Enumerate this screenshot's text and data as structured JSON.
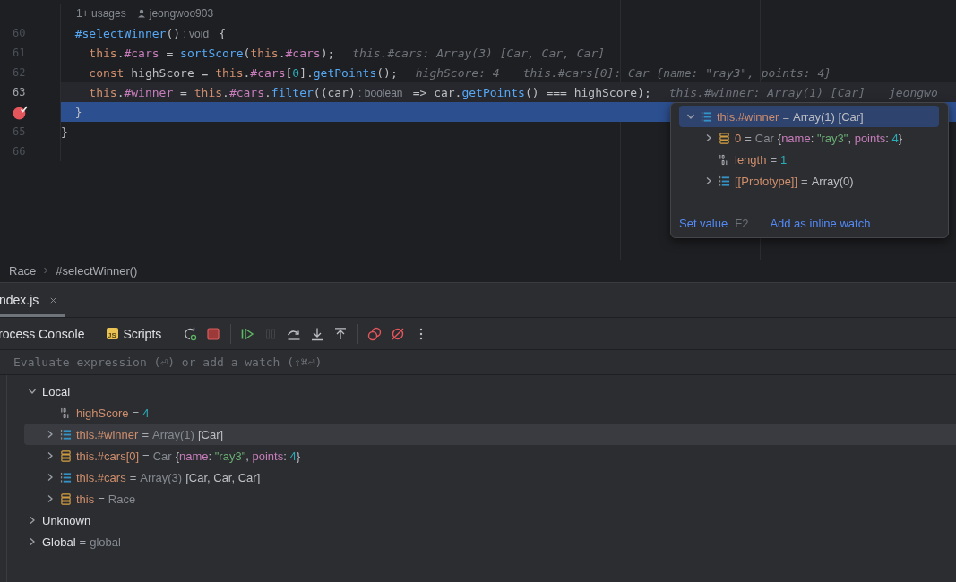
{
  "editor": {
    "usages": {
      "count": "1+ usages",
      "author": "jeongwoo903"
    },
    "lines": [
      {
        "number": "60",
        "breakpoint": false,
        "current_line": false,
        "execution_point": false,
        "tokens": [
          {
            "text": "  #selectWinner",
            "kind": "fn"
          },
          {
            "text": "()",
            "kind": "plain"
          },
          {
            "text": " : void ",
            "kind": "type_hint"
          },
          {
            "text": " {",
            "kind": "plain"
          }
        ]
      },
      {
        "number": "61",
        "breakpoint": false,
        "current_line": false,
        "execution_point": false,
        "tokens": [
          {
            "text": "    this",
            "kind": "kw"
          },
          {
            "text": ".",
            "kind": "plain"
          },
          {
            "text": "#cars",
            "kind": "field"
          },
          {
            "text": " = ",
            "kind": "plain"
          },
          {
            "text": "sortScore",
            "kind": "fn"
          },
          {
            "text": "(",
            "kind": "plain"
          },
          {
            "text": "this",
            "kind": "kw"
          },
          {
            "text": ".",
            "kind": "plain"
          },
          {
            "text": "#cars",
            "kind": "field"
          },
          {
            "text": ");",
            "kind": "plain"
          }
        ],
        "hints": [
          "this.#cars: Array(3) [Car, Car, Car]"
        ]
      },
      {
        "number": "62",
        "breakpoint": false,
        "current_line": false,
        "execution_point": false,
        "tokens": [
          {
            "text": "    const",
            "kind": "kw"
          },
          {
            "text": " highScore = ",
            "kind": "plain"
          },
          {
            "text": "this",
            "kind": "kw"
          },
          {
            "text": ".",
            "kind": "plain"
          },
          {
            "text": "#cars",
            "kind": "field"
          },
          {
            "text": "[",
            "kind": "plain"
          },
          {
            "text": "0",
            "kind": "num"
          },
          {
            "text": "].",
            "kind": "plain"
          },
          {
            "text": "getPoints",
            "kind": "fn"
          },
          {
            "text": "();",
            "kind": "plain"
          }
        ],
        "hints": [
          "highScore: 4",
          "this.#cars[0]: Car {name: \"ray3\", points: 4}"
        ]
      },
      {
        "number": "63",
        "breakpoint": false,
        "current_line": true,
        "execution_point": false,
        "tokens": [
          {
            "text": "    this",
            "kind": "kw"
          },
          {
            "text": ".",
            "kind": "plain"
          },
          {
            "text": "#winner",
            "kind": "field"
          },
          {
            "text": " = ",
            "kind": "plain"
          },
          {
            "text": "this",
            "kind": "kw"
          },
          {
            "text": ".",
            "kind": "plain"
          },
          {
            "text": "#cars",
            "kind": "field"
          },
          {
            "text": ".",
            "kind": "plain"
          },
          {
            "text": "filter",
            "kind": "fn"
          },
          {
            "text": "((car)",
            "kind": "plain"
          },
          {
            "text": " : boolean ",
            "kind": "type_hint"
          },
          {
            "text": " => car.",
            "kind": "plain"
          },
          {
            "text": "getPoints",
            "kind": "fn"
          },
          {
            "text": "() === highScore);",
            "kind": "plain"
          }
        ],
        "hints": [
          "this.#winner: Array(1) [Car]",
          "jeongwo"
        ]
      },
      {
        "breakpoint": true,
        "current_line": false,
        "execution_point": true,
        "tokens": [
          {
            "text": "  }",
            "kind": "plain"
          }
        ]
      },
      {
        "number": "65",
        "breakpoint": false,
        "current_line": false,
        "execution_point": false,
        "tokens": [
          {
            "text": "}",
            "kind": "plain"
          }
        ]
      },
      {
        "number": "66",
        "breakpoint": false,
        "current_line": false,
        "execution_point": false
      }
    ]
  },
  "popup": {
    "items": [
      {
        "kind": "array",
        "expanded": true,
        "selected": true,
        "name": "this.#winner",
        "value": [
          {
            "text": "=",
            "kind": "eq"
          },
          {
            "text": "Array(1) [Car]",
            "kind": "plain"
          }
        ],
        "children": [
          {
            "kind": "object",
            "expanded": false,
            "selected": false,
            "name": "0",
            "value": [
              {
                "text": "=",
                "kind": "eq"
              },
              {
                "text": "Car",
                "kind": "type"
              },
              {
                "text": "{",
                "kind": "plain"
              },
              {
                "text": "name",
                "kind": "key"
              },
              {
                "text": ": ",
                "kind": "plain"
              },
              {
                "text": "\"ray3\"",
                "kind": "str"
              },
              {
                "text": ", ",
                "kind": "plain"
              },
              {
                "text": "points",
                "kind": "key"
              },
              {
                "text": ": ",
                "kind": "plain"
              },
              {
                "text": "4",
                "kind": "num"
              },
              {
                "text": "}",
                "kind": "plain"
              }
            ]
          },
          {
            "kind": "number",
            "selected": false,
            "name": "length",
            "value": [
              {
                "text": "=",
                "kind": "eq"
              },
              {
                "text": "1",
                "kind": "num"
              }
            ]
          },
          {
            "kind": "array",
            "expanded": false,
            "selected": false,
            "name": "[[Prototype]]",
            "value": [
              {
                "text": "=",
                "kind": "eq"
              },
              {
                "text": "Array(0)",
                "kind": "plain"
              }
            ]
          }
        ]
      }
    ],
    "actions": [
      {
        "label": "Set value",
        "shortcut": "F2"
      },
      {
        "label": "Add as inline watch"
      }
    ]
  },
  "breadcrumb": [
    "Race",
    "#selectWinner()"
  ],
  "debug_tabs": [
    {
      "label": "ndex.js",
      "selected": true
    }
  ],
  "toolbar": {
    "tabs": [
      {
        "label": "rocess Console"
      },
      {
        "label": "Scripts",
        "badge": "JS"
      }
    ],
    "buttons": [
      {
        "kind": "rerun",
        "disabled": false
      },
      {
        "kind": "stop",
        "disabled": false
      },
      {
        "kind": "separator"
      },
      {
        "kind": "resume",
        "disabled": false
      },
      {
        "kind": "pause",
        "disabled": true
      },
      {
        "kind": "step_over",
        "disabled": false
      },
      {
        "kind": "step_into",
        "disabled": false
      },
      {
        "kind": "step_out",
        "disabled": false
      },
      {
        "kind": "separator"
      },
      {
        "kind": "breakpoints",
        "disabled": false
      },
      {
        "kind": "mute",
        "disabled": false
      },
      {
        "kind": "more",
        "disabled": false
      }
    ]
  },
  "evaluate": {
    "placeholder": "Evaluate expression (⏎) or add a watch (⇧⌘⏎)"
  },
  "variables": {
    "items": [
      {
        "kind": "scope",
        "expanded": true,
        "selected": false,
        "name": "Local",
        "children": [
          {
            "kind": "number",
            "selected": false,
            "name": "highScore",
            "value": [
              {
                "text": "=",
                "kind": "eq"
              },
              {
                "text": "4",
                "kind": "num"
              }
            ]
          },
          {
            "kind": "array",
            "expanded": false,
            "selected": true,
            "name": "this.#winner",
            "value": [
              {
                "text": "=",
                "kind": "eq"
              },
              {
                "text": "Array(1)",
                "kind": "type"
              },
              {
                "text": "[Car]",
                "kind": "plain"
              }
            ]
          },
          {
            "kind": "object",
            "expanded": false,
            "selected": false,
            "name": "this.#cars[0]",
            "value": [
              {
                "text": "=",
                "kind": "eq"
              },
              {
                "text": "Car",
                "kind": "type"
              },
              {
                "text": "{",
                "kind": "plain"
              },
              {
                "text": "name",
                "kind": "key"
              },
              {
                "text": ": ",
                "kind": "plain"
              },
              {
                "text": "\"ray3\"",
                "kind": "str"
              },
              {
                "text": ", ",
                "kind": "plain"
              },
              {
                "text": "points",
                "kind": "key"
              },
              {
                "text": ": ",
                "kind": "plain"
              },
              {
                "text": "4",
                "kind": "num"
              },
              {
                "text": "}",
                "kind": "plain"
              }
            ]
          },
          {
            "kind": "array",
            "expanded": false,
            "selected": false,
            "name": "this.#cars",
            "value": [
              {
                "text": "=",
                "kind": "eq"
              },
              {
                "text": "Array(3)",
                "kind": "type"
              },
              {
                "text": "[Car, Car, Car]",
                "kind": "plain"
              }
            ]
          },
          {
            "kind": "object",
            "expanded": false,
            "selected": false,
            "name": "this",
            "value": [
              {
                "text": "=",
                "kind": "eq"
              },
              {
                "text": "Race",
                "kind": "type"
              }
            ]
          }
        ]
      },
      {
        "kind": "scope",
        "expanded": false,
        "selected": false,
        "name": "Unknown"
      },
      {
        "kind": "scope",
        "expanded": false,
        "selected": false,
        "name": "Global",
        "value": [
          {
            "text": "=",
            "kind": "eq"
          },
          {
            "text": "global",
            "kind": "type"
          }
        ]
      }
    ]
  }
}
